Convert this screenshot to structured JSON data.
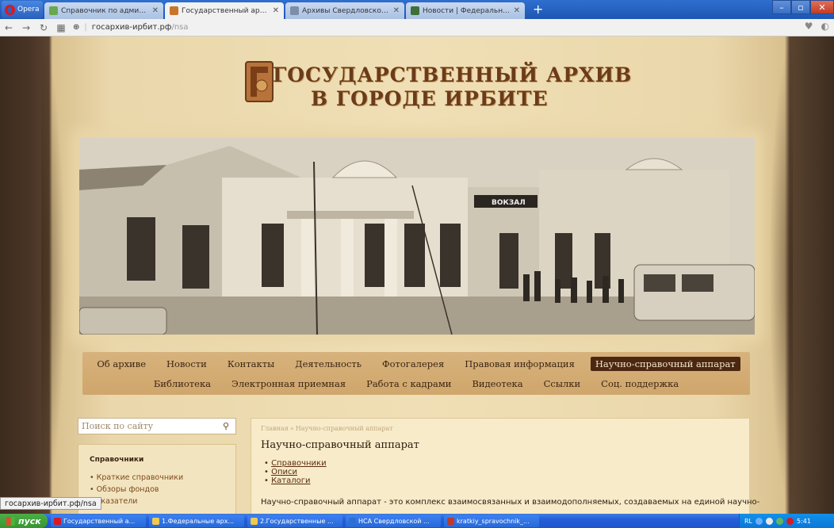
{
  "browser": {
    "app_label": "Opera",
    "tabs": [
      {
        "title": "Справочник по администр",
        "active": false
      },
      {
        "title": "Государственный архив в г",
        "active": true
      },
      {
        "title": "Архивы Свердловской обл",
        "active": false
      },
      {
        "title": "Новости | Федеральное арх",
        "active": false
      }
    ],
    "new_tab_label": "+",
    "url_host": "госархив-ирбит.рф",
    "url_path": "/nsa",
    "status_url": "госархив-ирбит.рф/nsa"
  },
  "site": {
    "title_line1": "ГОСУДАРСТВЕННЫЙ АРХИВ",
    "title_line2": "В ГОРОДЕ ИРБИТЕ",
    "hero_sign": "ВОКЗАЛ"
  },
  "menu": {
    "row1": [
      "Об архиве",
      "Новости",
      "Контакты",
      "Деятельность",
      "Фотогалерея",
      "Правовая информация",
      "Научно-справочный аппарат"
    ],
    "row2": [
      "Библиотека",
      "Электронная приемная",
      "Работа с кадрами",
      "Видеотека",
      "Ссылки",
      "Соц. поддержка"
    ],
    "active": "Научно-справочный аппарат"
  },
  "search": {
    "placeholder": "Поиск по сайту"
  },
  "sidebar": {
    "title": "Справочники",
    "links": [
      "• Краткие справочники",
      "• Обзоры фондов",
      "• Указатели"
    ]
  },
  "content": {
    "breadcrumb_home": "Главная",
    "breadcrumb_sep": "»",
    "breadcrumb_current": "Научно-справочный аппарат",
    "page_title": "Научно-справочный аппарат",
    "list": [
      "Справочники",
      "Описи",
      "Каталоги"
    ],
    "text": "Научно-справочный аппарат - это комплекс взаимосвязанных и взаимодополняемых, создаваемых на единой научно-"
  },
  "taskbar": {
    "start_label": "пуск",
    "tasks": [
      "Государственный а...",
      "1.Федеральные арх...",
      "2.Государственные ...",
      "НСА Свердловской ...",
      "kratkiy_spravochnik_..."
    ],
    "tray_lang": "RL",
    "clock": "5:41"
  }
}
